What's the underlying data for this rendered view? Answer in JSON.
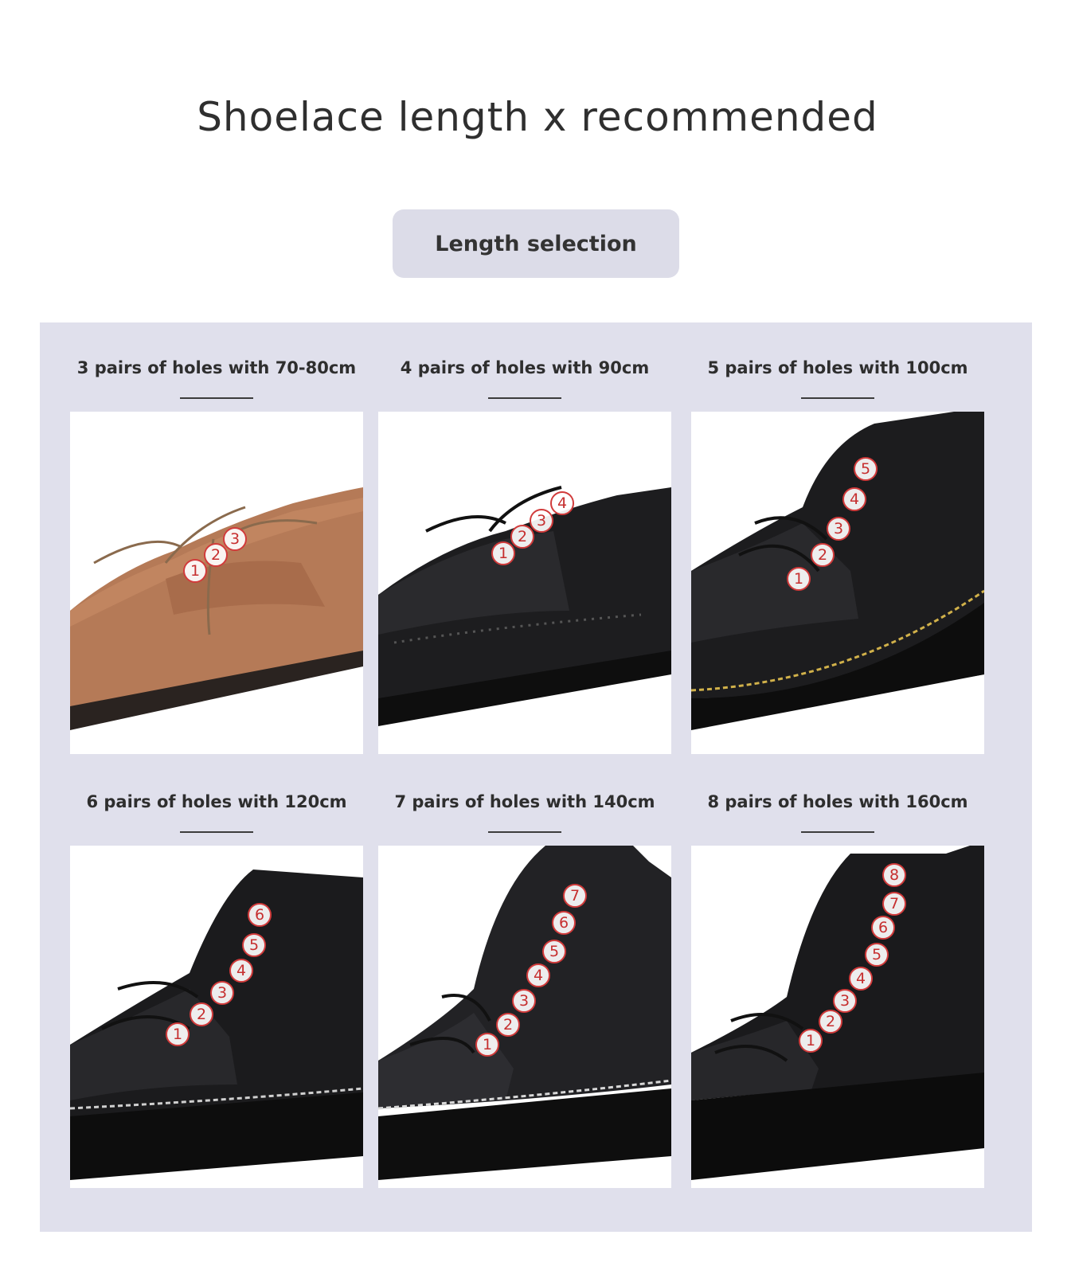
{
  "title": "Shoelace length x recommended",
  "selector_label": "Length selection",
  "cards": [
    {
      "caption": "3 pairs of holes with 70-80cm",
      "shoe": "brown leather derby shoe",
      "holes": [
        "1",
        "2",
        "3"
      ]
    },
    {
      "caption": "4 pairs of holes with 90cm",
      "shoe": "black leather brogue shoe",
      "holes": [
        "1",
        "2",
        "3",
        "4"
      ]
    },
    {
      "caption": "5 pairs of holes with 100cm",
      "shoe": "black leather ankle boot",
      "holes": [
        "1",
        "2",
        "3",
        "4",
        "5"
      ]
    },
    {
      "caption": "6 pairs of holes with 120cm",
      "shoe": "black leather ankle boot",
      "holes": [
        "1",
        "2",
        "3",
        "4",
        "5",
        "6"
      ]
    },
    {
      "caption": "7 pairs of holes with 140cm",
      "shoe": "black pebbled leather boot",
      "holes": [
        "1",
        "2",
        "3",
        "4",
        "5",
        "6",
        "7"
      ]
    },
    {
      "caption": "8 pairs of holes with 160cm",
      "shoe": "black leather combat boot",
      "holes": [
        "1",
        "2",
        "3",
        "4",
        "5",
        "6",
        "7",
        "8"
      ]
    }
  ],
  "colors": {
    "panel": "#e0e0ec",
    "pill": "#dcdce8",
    "hole_marker": "#d13b3b"
  }
}
